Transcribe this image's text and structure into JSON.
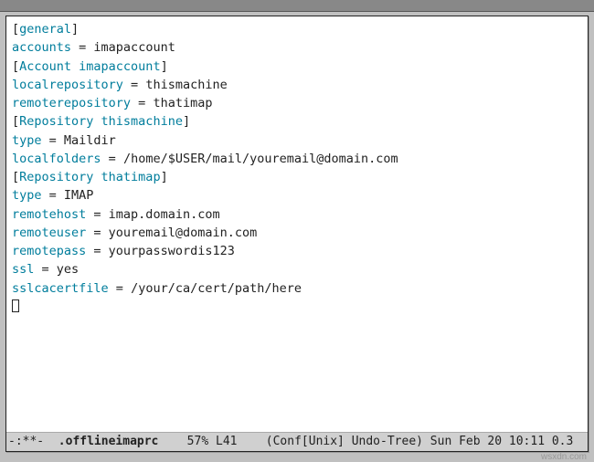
{
  "sections": [
    {
      "header_open": "[",
      "header_name": "general",
      "header_close": "]",
      "entries": [
        {
          "key": "accounts",
          "value": "imapaccount"
        }
      ]
    },
    {
      "header_open": "[",
      "header_name": "Account imapaccount",
      "header_close": "]",
      "entries": [
        {
          "key": "localrepository",
          "value": "thismachine"
        },
        {
          "key": "remoterepository",
          "value": "thatimap"
        }
      ]
    },
    {
      "header_open": "[",
      "header_name": "Repository thismachine",
      "header_close": "]",
      "entries": [
        {
          "key": "type",
          "value": "Maildir"
        },
        {
          "key": "localfolders",
          "value": "/home/$USER/mail/youremail@domain.com"
        }
      ]
    },
    {
      "header_open": "[",
      "header_name": "Repository thatimap",
      "header_close": "]",
      "entries": [
        {
          "key": "type",
          "value": "IMAP"
        },
        {
          "key": "remotehost",
          "value": "imap.domain.com"
        },
        {
          "key": "remoteuser",
          "value": "youremail@domain.com"
        },
        {
          "key": "remotepass",
          "value": "yourpasswordis123"
        },
        {
          "key": "ssl",
          "value": "yes"
        },
        {
          "key": "sslcacertfile",
          "value": "/your/ca/cert/path/here"
        }
      ]
    }
  ],
  "modeline": {
    "left": "-:**-  ",
    "file": ".offlineimaprc",
    "pos": "    57% L41    ",
    "modes": "(Conf[Unix] Undo-Tree) ",
    "datetime": "Sun Feb 20 10:11 0.3"
  },
  "watermark": "wsxdn.com"
}
